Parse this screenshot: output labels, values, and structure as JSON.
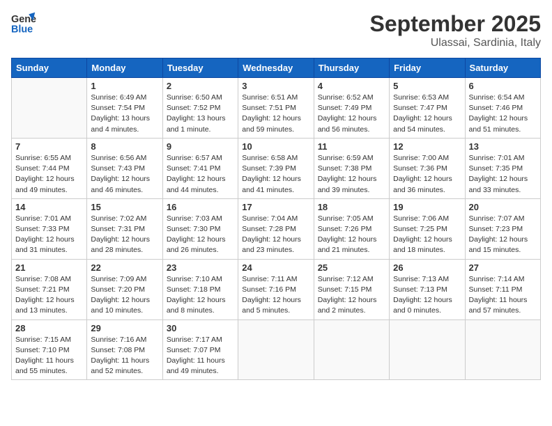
{
  "logo": {
    "line1": "General",
    "line2": "Blue"
  },
  "title": "September 2025",
  "location": "Ulassai, Sardinia, Italy",
  "days_of_week": [
    "Sunday",
    "Monday",
    "Tuesday",
    "Wednesday",
    "Thursday",
    "Friday",
    "Saturday"
  ],
  "weeks": [
    [
      {
        "day": "",
        "sunrise": "",
        "sunset": "",
        "daylight": ""
      },
      {
        "day": "1",
        "sunrise": "Sunrise: 6:49 AM",
        "sunset": "Sunset: 7:54 PM",
        "daylight": "Daylight: 13 hours and 4 minutes."
      },
      {
        "day": "2",
        "sunrise": "Sunrise: 6:50 AM",
        "sunset": "Sunset: 7:52 PM",
        "daylight": "Daylight: 13 hours and 1 minute."
      },
      {
        "day": "3",
        "sunrise": "Sunrise: 6:51 AM",
        "sunset": "Sunset: 7:51 PM",
        "daylight": "Daylight: 12 hours and 59 minutes."
      },
      {
        "day": "4",
        "sunrise": "Sunrise: 6:52 AM",
        "sunset": "Sunset: 7:49 PM",
        "daylight": "Daylight: 12 hours and 56 minutes."
      },
      {
        "day": "5",
        "sunrise": "Sunrise: 6:53 AM",
        "sunset": "Sunset: 7:47 PM",
        "daylight": "Daylight: 12 hours and 54 minutes."
      },
      {
        "day": "6",
        "sunrise": "Sunrise: 6:54 AM",
        "sunset": "Sunset: 7:46 PM",
        "daylight": "Daylight: 12 hours and 51 minutes."
      }
    ],
    [
      {
        "day": "7",
        "sunrise": "Sunrise: 6:55 AM",
        "sunset": "Sunset: 7:44 PM",
        "daylight": "Daylight: 12 hours and 49 minutes."
      },
      {
        "day": "8",
        "sunrise": "Sunrise: 6:56 AM",
        "sunset": "Sunset: 7:43 PM",
        "daylight": "Daylight: 12 hours and 46 minutes."
      },
      {
        "day": "9",
        "sunrise": "Sunrise: 6:57 AM",
        "sunset": "Sunset: 7:41 PM",
        "daylight": "Daylight: 12 hours and 44 minutes."
      },
      {
        "day": "10",
        "sunrise": "Sunrise: 6:58 AM",
        "sunset": "Sunset: 7:39 PM",
        "daylight": "Daylight: 12 hours and 41 minutes."
      },
      {
        "day": "11",
        "sunrise": "Sunrise: 6:59 AM",
        "sunset": "Sunset: 7:38 PM",
        "daylight": "Daylight: 12 hours and 39 minutes."
      },
      {
        "day": "12",
        "sunrise": "Sunrise: 7:00 AM",
        "sunset": "Sunset: 7:36 PM",
        "daylight": "Daylight: 12 hours and 36 minutes."
      },
      {
        "day": "13",
        "sunrise": "Sunrise: 7:01 AM",
        "sunset": "Sunset: 7:35 PM",
        "daylight": "Daylight: 12 hours and 33 minutes."
      }
    ],
    [
      {
        "day": "14",
        "sunrise": "Sunrise: 7:01 AM",
        "sunset": "Sunset: 7:33 PM",
        "daylight": "Daylight: 12 hours and 31 minutes."
      },
      {
        "day": "15",
        "sunrise": "Sunrise: 7:02 AM",
        "sunset": "Sunset: 7:31 PM",
        "daylight": "Daylight: 12 hours and 28 minutes."
      },
      {
        "day": "16",
        "sunrise": "Sunrise: 7:03 AM",
        "sunset": "Sunset: 7:30 PM",
        "daylight": "Daylight: 12 hours and 26 minutes."
      },
      {
        "day": "17",
        "sunrise": "Sunrise: 7:04 AM",
        "sunset": "Sunset: 7:28 PM",
        "daylight": "Daylight: 12 hours and 23 minutes."
      },
      {
        "day": "18",
        "sunrise": "Sunrise: 7:05 AM",
        "sunset": "Sunset: 7:26 PM",
        "daylight": "Daylight: 12 hours and 21 minutes."
      },
      {
        "day": "19",
        "sunrise": "Sunrise: 7:06 AM",
        "sunset": "Sunset: 7:25 PM",
        "daylight": "Daylight: 12 hours and 18 minutes."
      },
      {
        "day": "20",
        "sunrise": "Sunrise: 7:07 AM",
        "sunset": "Sunset: 7:23 PM",
        "daylight": "Daylight: 12 hours and 15 minutes."
      }
    ],
    [
      {
        "day": "21",
        "sunrise": "Sunrise: 7:08 AM",
        "sunset": "Sunset: 7:21 PM",
        "daylight": "Daylight: 12 hours and 13 minutes."
      },
      {
        "day": "22",
        "sunrise": "Sunrise: 7:09 AM",
        "sunset": "Sunset: 7:20 PM",
        "daylight": "Daylight: 12 hours and 10 minutes."
      },
      {
        "day": "23",
        "sunrise": "Sunrise: 7:10 AM",
        "sunset": "Sunset: 7:18 PM",
        "daylight": "Daylight: 12 hours and 8 minutes."
      },
      {
        "day": "24",
        "sunrise": "Sunrise: 7:11 AM",
        "sunset": "Sunset: 7:16 PM",
        "daylight": "Daylight: 12 hours and 5 minutes."
      },
      {
        "day": "25",
        "sunrise": "Sunrise: 7:12 AM",
        "sunset": "Sunset: 7:15 PM",
        "daylight": "Daylight: 12 hours and 2 minutes."
      },
      {
        "day": "26",
        "sunrise": "Sunrise: 7:13 AM",
        "sunset": "Sunset: 7:13 PM",
        "daylight": "Daylight: 12 hours and 0 minutes."
      },
      {
        "day": "27",
        "sunrise": "Sunrise: 7:14 AM",
        "sunset": "Sunset: 7:11 PM",
        "daylight": "Daylight: 11 hours and 57 minutes."
      }
    ],
    [
      {
        "day": "28",
        "sunrise": "Sunrise: 7:15 AM",
        "sunset": "Sunset: 7:10 PM",
        "daylight": "Daylight: 11 hours and 55 minutes."
      },
      {
        "day": "29",
        "sunrise": "Sunrise: 7:16 AM",
        "sunset": "Sunset: 7:08 PM",
        "daylight": "Daylight: 11 hours and 52 minutes."
      },
      {
        "day": "30",
        "sunrise": "Sunrise: 7:17 AM",
        "sunset": "Sunset: 7:07 PM",
        "daylight": "Daylight: 11 hours and 49 minutes."
      },
      {
        "day": "",
        "sunrise": "",
        "sunset": "",
        "daylight": ""
      },
      {
        "day": "",
        "sunrise": "",
        "sunset": "",
        "daylight": ""
      },
      {
        "day": "",
        "sunrise": "",
        "sunset": "",
        "daylight": ""
      },
      {
        "day": "",
        "sunrise": "",
        "sunset": "",
        "daylight": ""
      }
    ]
  ]
}
